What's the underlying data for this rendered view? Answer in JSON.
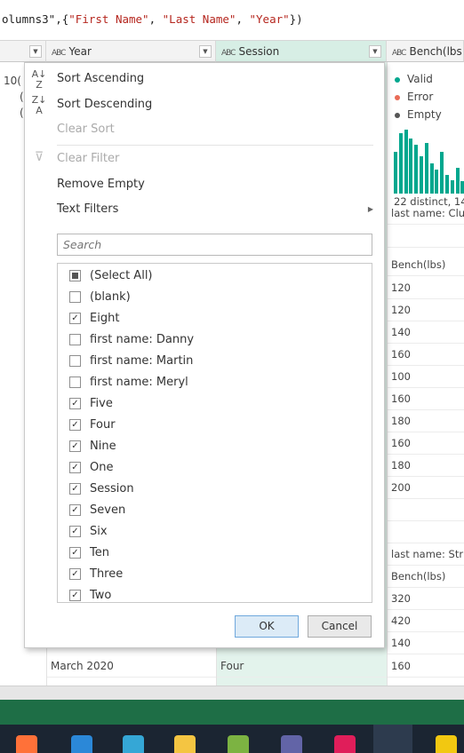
{
  "formula": {
    "prefix": "olumns3\",{",
    "items": [
      "\"First Name\"",
      ", ",
      "\"Last Name\"",
      ", ",
      "\"Year\""
    ],
    "suffix": "})"
  },
  "columns": {
    "year": {
      "type_icon": "ABC",
      "label": "Year"
    },
    "session": {
      "type_icon": "ABC",
      "label": "Session"
    },
    "bench": {
      "type_icon": "ABC",
      "label": "Bench(lbs"
    }
  },
  "left_cells": {
    "row1": "10(",
    "row2": "(",
    "row3": "("
  },
  "profile": {
    "legend": [
      {
        "label": "Valid",
        "color": "#00a78e"
      },
      {
        "label": "Error",
        "color": "#e96b56"
      },
      {
        "label": "Empty",
        "color": "#555555"
      }
    ],
    "histogram": [
      0.62,
      0.9,
      0.95,
      0.82,
      0.72,
      0.55,
      0.75,
      0.45,
      0.35,
      0.62,
      0.28,
      0.2,
      0.38,
      0.18
    ],
    "distinct_text": "22 distinct, 14"
  },
  "bench_cells": [
    "last name: Clu",
    "",
    "Bench(lbs)",
    "120",
    "120",
    "140",
    "160",
    "100",
    "160",
    "180",
    "160",
    "180",
    "200",
    "",
    "",
    "last name: Str",
    "Bench(lbs)",
    "320",
    "420",
    "140",
    "160"
  ],
  "last_row": {
    "year": "March 2020",
    "session": "Four"
  },
  "menu": {
    "sort_asc": "Sort Ascending",
    "sort_desc": "Sort Descending",
    "clear_sort": "Clear Sort",
    "clear_filter": "Clear Filter",
    "remove_empty": "Remove Empty",
    "text_filters": "Text Filters"
  },
  "search": {
    "placeholder": "Search",
    "value": ""
  },
  "filter_options": [
    {
      "label": "(Select All)",
      "state": "partial"
    },
    {
      "label": "(blank)",
      "state": "unchecked"
    },
    {
      "label": "Eight",
      "state": "checked"
    },
    {
      "label": "first name: Danny",
      "state": "unchecked"
    },
    {
      "label": "first name: Martin",
      "state": "unchecked"
    },
    {
      "label": "first name: Meryl",
      "state": "unchecked"
    },
    {
      "label": "Five",
      "state": "checked"
    },
    {
      "label": "Four",
      "state": "checked"
    },
    {
      "label": "Nine",
      "state": "checked"
    },
    {
      "label": "One",
      "state": "checked"
    },
    {
      "label": "Session",
      "state": "checked"
    },
    {
      "label": "Seven",
      "state": "checked"
    },
    {
      "label": "Six",
      "state": "checked"
    },
    {
      "label": "Ten",
      "state": "checked"
    },
    {
      "label": "Three",
      "state": "checked"
    },
    {
      "label": "Two",
      "state": "checked"
    }
  ],
  "buttons": {
    "ok": "OK",
    "cancel": "Cancel"
  },
  "taskbar": [
    {
      "name": "firefox-icon",
      "color": "#ff7139"
    },
    {
      "name": "store-icon",
      "color": "#2b88d8"
    },
    {
      "name": "edge-icon",
      "color": "#35a7d6"
    },
    {
      "name": "file-explorer-icon",
      "color": "#f4c542"
    },
    {
      "name": "notepad-icon",
      "color": "#7cb342"
    },
    {
      "name": "teams-icon",
      "color": "#6264a7"
    },
    {
      "name": "slack-icon",
      "color": "#e01e5a"
    },
    {
      "name": "excel-icon",
      "color": "#1d7044"
    },
    {
      "name": "power-bi-icon",
      "color": "#f2c811"
    }
  ]
}
